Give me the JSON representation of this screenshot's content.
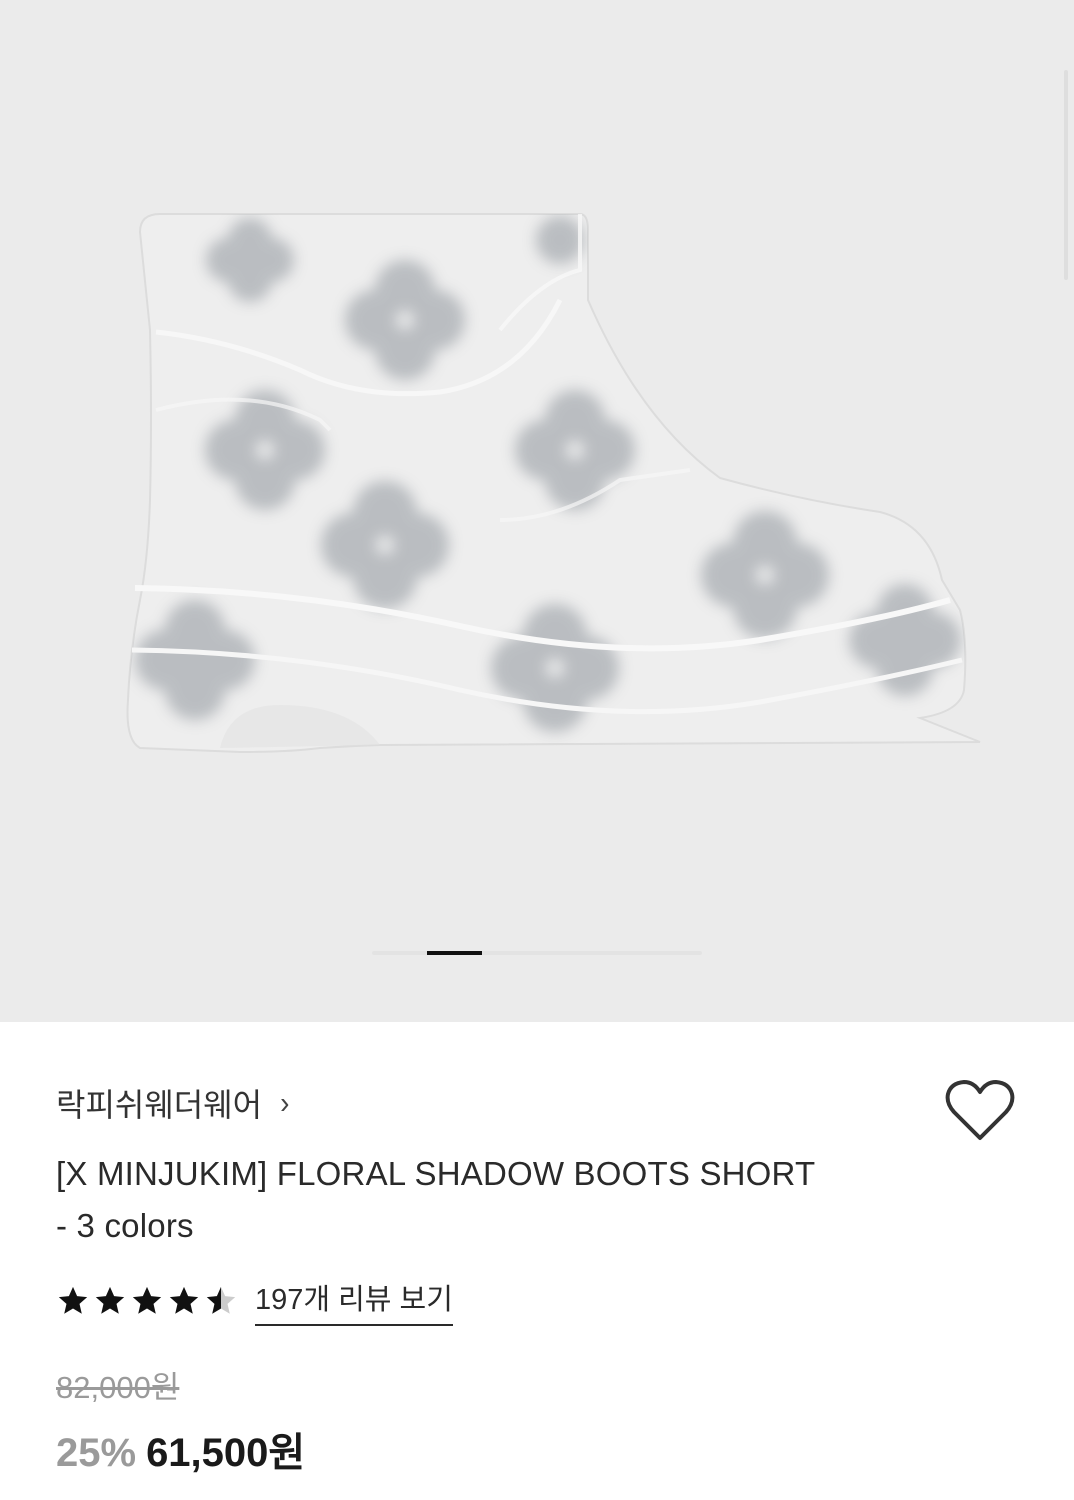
{
  "product": {
    "image": {
      "name": "product-photo",
      "description_icon": "boot-image"
    },
    "gallery_indicator": {
      "current_page": 2,
      "total_pages": 6
    },
    "brand": "락피쉬웨더웨어",
    "title_line1": "[X MINJUKIM] FLORAL SHADOW BOOTS SHORT",
    "title_line2": "- 3 colors",
    "rating": 4.5,
    "review_link_label": "197개 리뷰 보기",
    "original_price": "82,000원",
    "discount": "25%",
    "sale_price": "61,500원"
  },
  "icons": {
    "brand_chevron": "chevron-right-icon",
    "wishlist": "heart-outline-icon",
    "star": "star-icon"
  },
  "colors": {
    "gallery_bg": "#ebebeb",
    "text_primary": "#222222",
    "text_muted": "#9a9a9a",
    "indicator_active": "#111111"
  }
}
